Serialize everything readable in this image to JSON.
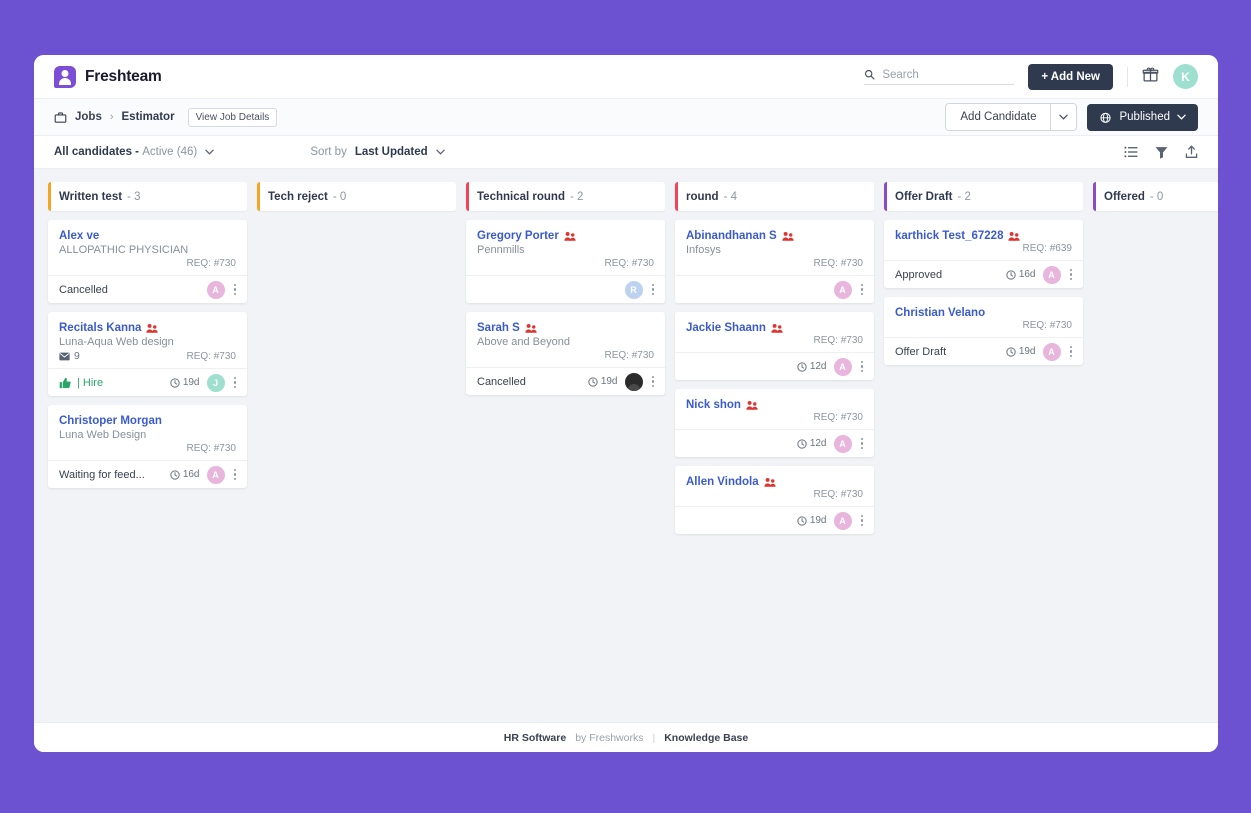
{
  "theme": {
    "page_bg": "#6c52d0",
    "board_bg": "#f1f3f6",
    "link_blue": "#3b5bcc",
    "dark_button": "#2f3a4f"
  },
  "topbar": {
    "brand": "Freshteam",
    "brand_icon": "user-badge-icon",
    "search_placeholder": "Search",
    "search_value": "",
    "search_icon": "search-icon",
    "add_new_label": "+ Add New",
    "gift_icon": "gift-icon",
    "avatar_initial": "K"
  },
  "breadcrumb": {
    "briefcase_icon": "briefcase-icon",
    "jobs_label": "Jobs",
    "separator": "›",
    "current": "Estimator",
    "view_job_details": "View Job Details",
    "add_candidate": "Add Candidate",
    "add_candidate_caret": "chevron-down-icon",
    "published_label": "Published",
    "published_icon": "globe-icon",
    "published_caret": "chevron-down-icon"
  },
  "filterbar": {
    "title_main": "All candidates -",
    "title_sub": "Active",
    "count": "(46)",
    "caret": "chevron-down-icon",
    "sort_label": "Sort by",
    "sort_value": "Last Updated",
    "sort_caret": "chevron-down-icon",
    "icons": [
      "list-view-icon",
      "filter-icon",
      "export-icon"
    ]
  },
  "board": {
    "columns": [
      {
        "title": "Written test",
        "dash": "-",
        "count": "3",
        "accent": "#f4a623",
        "cards": [
          {
            "name": "Alex ve",
            "has_source_icon": false,
            "subtitle": "ALLOPATHIC PHYSICIAN",
            "mail_count": "",
            "req": "REQ: #730",
            "status": "Cancelled",
            "status_kind": "plain",
            "age": "",
            "avatar_letter": "A",
            "avatar_color": "#e8b5dd",
            "avatar_kind": "letter"
          },
          {
            "name": "Recitals Kanna",
            "has_source_icon": true,
            "subtitle": "Luna-Aqua Web design",
            "mail_count": "9",
            "req": "REQ: #730",
            "status": "| Hire",
            "status_kind": "hire",
            "age": "19d",
            "avatar_letter": "J",
            "avatar_color": "#9fdfd0",
            "avatar_kind": "letter"
          },
          {
            "name": "Christoper Morgan",
            "has_source_icon": false,
            "subtitle": "Luna Web Design",
            "mail_count": "",
            "req": "REQ: #730",
            "status": "Waiting for feed...",
            "status_kind": "plain",
            "age": "16d",
            "avatar_letter": "A",
            "avatar_color": "#e8b5dd",
            "avatar_kind": "letter"
          }
        ]
      },
      {
        "title": "Tech reject",
        "dash": "-",
        "count": "0",
        "accent": "#f4a623",
        "cards": []
      },
      {
        "title": "Technical round",
        "dash": "-",
        "count": "2",
        "accent": "#f04459",
        "cards": [
          {
            "name": "Gregory Porter",
            "has_source_icon": true,
            "subtitle": "Pennmills",
            "mail_count": "",
            "req": "REQ: #730",
            "status": "",
            "status_kind": "plain",
            "age": "",
            "avatar_letter": "R",
            "avatar_color": "#bcd2ee",
            "avatar_kind": "letter"
          },
          {
            "name": "Sarah S",
            "has_source_icon": true,
            "subtitle": "Above and Beyond",
            "mail_count": "",
            "req": "REQ: #730",
            "status": "Cancelled",
            "status_kind": "plain",
            "age": "19d",
            "avatar_letter": "",
            "avatar_color": "#2b2b2b",
            "avatar_kind": "photo"
          }
        ]
      },
      {
        "title": "round",
        "dash": "-",
        "count": "4",
        "accent": "#f04459",
        "cards": [
          {
            "name": "Abinandhanan S",
            "has_source_icon": true,
            "subtitle": "Infosys",
            "mail_count": "",
            "req": "REQ: #730",
            "status": "",
            "status_kind": "plain",
            "age": "",
            "avatar_letter": "A",
            "avatar_color": "#e8b5dd",
            "avatar_kind": "letter"
          },
          {
            "name": "Jackie Shaann",
            "has_source_icon": true,
            "subtitle": "",
            "mail_count": "",
            "req": "REQ: #730",
            "status": "",
            "status_kind": "plain",
            "age": "12d",
            "avatar_letter": "A",
            "avatar_color": "#e8b5dd",
            "avatar_kind": "letter"
          },
          {
            "name": "Nick shon",
            "has_source_icon": true,
            "subtitle": "",
            "mail_count": "",
            "req": "REQ: #730",
            "status": "",
            "status_kind": "plain",
            "age": "12d",
            "avatar_letter": "A",
            "avatar_color": "#e8b5dd",
            "avatar_kind": "letter"
          },
          {
            "name": "Allen Vindola",
            "has_source_icon": true,
            "subtitle": "",
            "mail_count": "",
            "req": "REQ: #730",
            "status": "",
            "status_kind": "plain",
            "age": "19d",
            "avatar_letter": "A",
            "avatar_color": "#e8b5dd",
            "avatar_kind": "letter"
          }
        ]
      },
      {
        "title": "Offer Draft",
        "dash": "-",
        "count": "2",
        "accent": "#8b4bc4",
        "cards": [
          {
            "name": "karthick Test_67228",
            "has_source_icon": true,
            "subtitle": "",
            "mail_count": "",
            "req": "REQ: #639",
            "status": "Approved",
            "status_kind": "plain",
            "age": "16d",
            "avatar_letter": "A",
            "avatar_color": "#e8b5dd",
            "avatar_kind": "letter"
          },
          {
            "name": "Christian Velano",
            "has_source_icon": false,
            "subtitle": "",
            "mail_count": "",
            "req": "REQ: #730",
            "status": "Offer Draft",
            "status_kind": "plain",
            "age": "19d",
            "avatar_letter": "A",
            "avatar_color": "#e8b5dd",
            "avatar_kind": "letter"
          }
        ]
      },
      {
        "title": "Offered",
        "dash": "-",
        "count": "0",
        "accent": "#8b4bc4",
        "cards": []
      }
    ]
  },
  "footer": {
    "product": "HR Software",
    "by": "by Freshworks",
    "separator": "|",
    "link": "Knowledge Base"
  }
}
